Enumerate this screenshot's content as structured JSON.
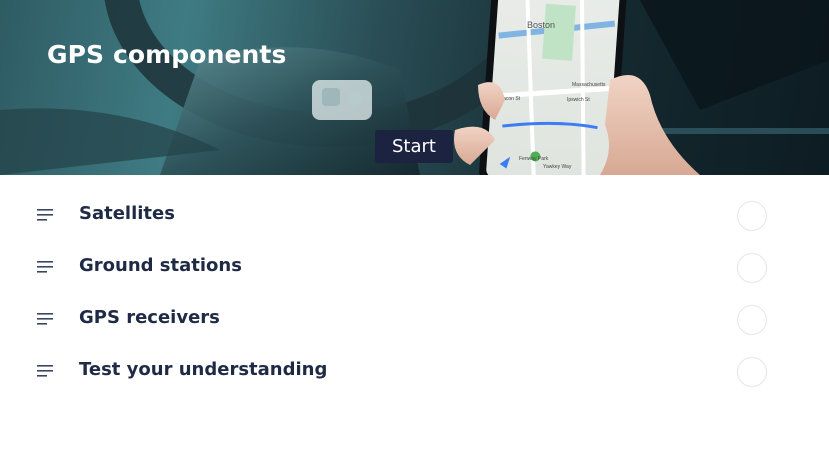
{
  "header": {
    "title": "GPS components",
    "start_label": "Start"
  },
  "map": {
    "city": "Boston",
    "labels": [
      "Beacon St",
      "Ipswich St",
      "Massachusetts",
      "Fenway Park",
      "Yawkey Way"
    ]
  },
  "lessons": [
    {
      "title": "Satellites",
      "icon": "lines-icon",
      "completed": false
    },
    {
      "title": "Ground stations",
      "icon": "lines-icon",
      "completed": false
    },
    {
      "title": "GPS receivers",
      "icon": "lines-icon",
      "completed": false
    },
    {
      "title": "Test your understanding",
      "icon": "lines-icon",
      "completed": false
    }
  ],
  "colors": {
    "accent": "#1c2340",
    "text": "#1f2a44"
  }
}
